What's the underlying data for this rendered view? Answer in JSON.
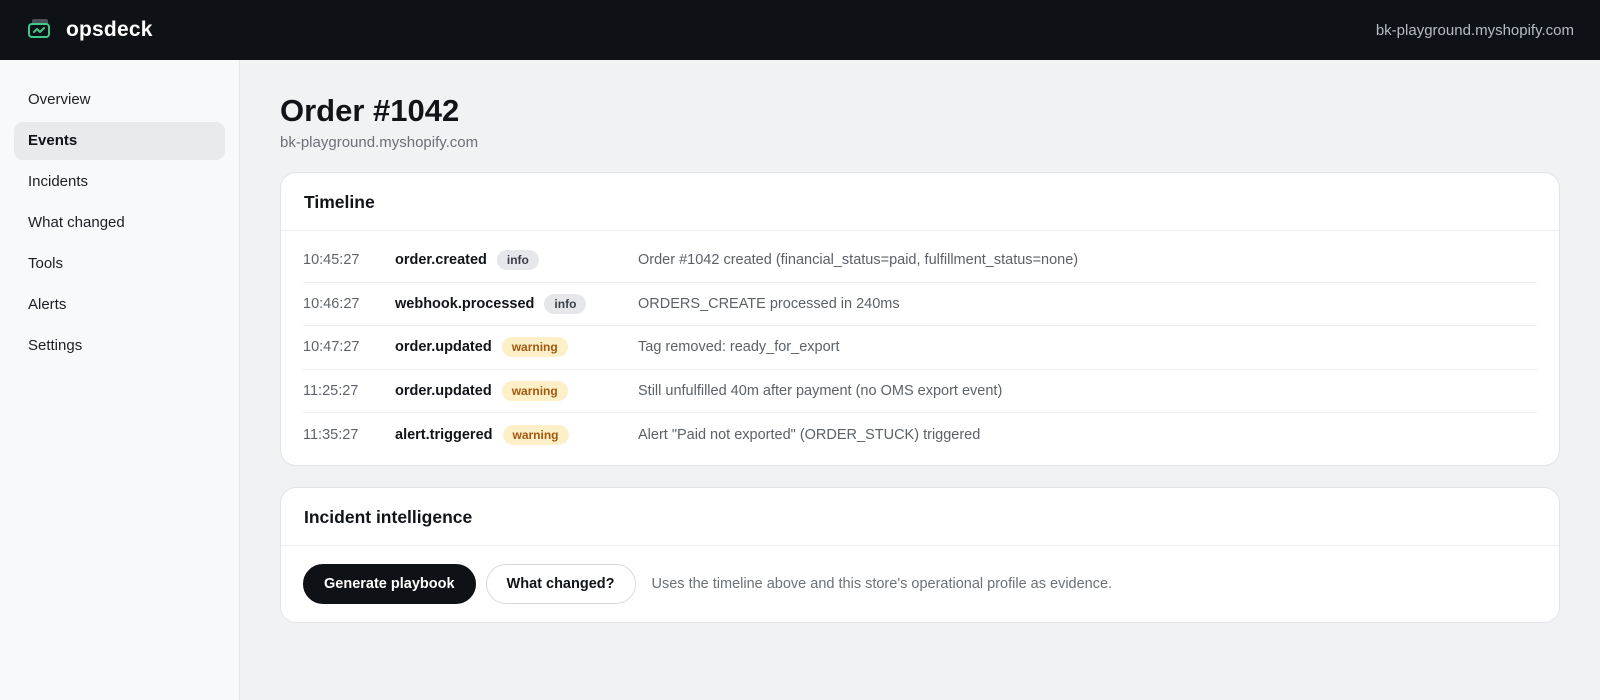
{
  "header": {
    "brand": "opsdeck",
    "store": "bk-playground.myshopify.com"
  },
  "sidebar": {
    "items": [
      {
        "label": "Overview",
        "active": false
      },
      {
        "label": "Events",
        "active": true
      },
      {
        "label": "Incidents",
        "active": false
      },
      {
        "label": "What changed",
        "active": false
      },
      {
        "label": "Tools",
        "active": false
      },
      {
        "label": "Alerts",
        "active": false
      },
      {
        "label": "Settings",
        "active": false
      }
    ]
  },
  "page": {
    "title": "Order #1042",
    "subtitle": "bk-playground.myshopify.com"
  },
  "timeline": {
    "title": "Timeline",
    "rows": [
      {
        "time": "10:45:27",
        "type": "order.created",
        "level": "info",
        "message": "Order #1042 created (financial_status=paid, fulfillment_status=none)"
      },
      {
        "time": "10:46:27",
        "type": "webhook.processed",
        "level": "info",
        "message": "ORDERS_CREATE processed in 240ms"
      },
      {
        "time": "10:47:27",
        "type": "order.updated",
        "level": "warning",
        "message": "Tag removed: ready_for_export"
      },
      {
        "time": "11:25:27",
        "type": "order.updated",
        "level": "warning",
        "message": "Still unfulfilled 40m after payment (no OMS export event)"
      },
      {
        "time": "11:35:27",
        "type": "alert.triggered",
        "level": "warning",
        "message": "Alert \"Paid not exported\" (ORDER_STUCK) triggered"
      }
    ]
  },
  "intelligence": {
    "title": "Incident intelligence",
    "primary_button": "Generate playbook",
    "secondary_button": "What changed?",
    "note": "Uses the timeline above and this store's operational profile as evidence."
  },
  "colors": {
    "topbar": "#0e1116",
    "logo_accent": "#3ec98a",
    "badge_info_bg": "#e5e7eb",
    "badge_warning_bg": "#fdf0c8",
    "badge_warning_text": "#a3580f"
  }
}
